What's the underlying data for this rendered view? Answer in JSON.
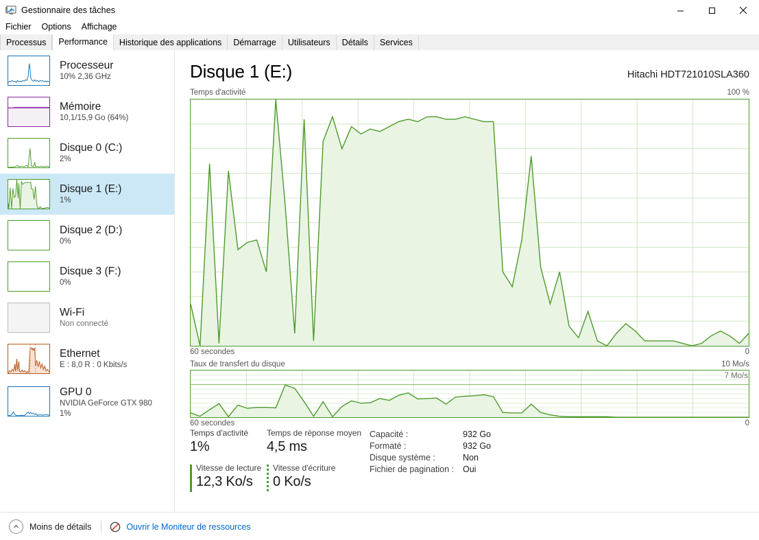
{
  "window": {
    "title": "Gestionnaire des tâches",
    "icon": "task-manager-icon",
    "minimize_glyph": "—",
    "maximize_glyph": "☐",
    "close_glyph": "✕"
  },
  "menu": {
    "items": [
      {
        "label": "Fichier"
      },
      {
        "label": "Options"
      },
      {
        "label": "Affichage"
      }
    ]
  },
  "tabs": {
    "active": "Performance",
    "items": [
      {
        "label": "Processus"
      },
      {
        "label": "Performance"
      },
      {
        "label": "Historique des applications"
      },
      {
        "label": "Démarrage"
      },
      {
        "label": "Utilisateurs"
      },
      {
        "label": "Détails"
      },
      {
        "label": "Services"
      }
    ]
  },
  "sidebar": {
    "items": [
      {
        "name": "cpu",
        "title": "Processeur",
        "sub": "10% 2,36 GHz",
        "color": "#1473b5",
        "selected": false,
        "muted": false
      },
      {
        "name": "memory",
        "title": "Mémoire",
        "sub": "10,1/15,9 Go (64%)",
        "color": "#8b24a8",
        "selected": false,
        "muted": false
      },
      {
        "name": "disk-0-c",
        "title": "Disque 0 (C:)",
        "sub": "2%",
        "color": "#4c9a2a",
        "selected": false,
        "muted": false
      },
      {
        "name": "disk-1-e",
        "title": "Disque 1 (E:)",
        "sub": "1%",
        "color": "#4c9a2a",
        "selected": true,
        "muted": false
      },
      {
        "name": "disk-2-d",
        "title": "Disque 2 (D:)",
        "sub": "0%",
        "color": "#4c9a2a",
        "selected": false,
        "muted": false
      },
      {
        "name": "disk-3-f",
        "title": "Disque 3 (F:)",
        "sub": "0%",
        "color": "#4c9a2a",
        "selected": false,
        "muted": false
      },
      {
        "name": "wifi",
        "title": "Wi-Fi",
        "sub": "Non connecté",
        "color": "#a8a8a8",
        "selected": false,
        "muted": true
      },
      {
        "name": "ethernet",
        "title": "Ethernet",
        "sub": "E : 8,0 R : 0 Kbits/s",
        "color": "#b5551d",
        "selected": false,
        "muted": false
      },
      {
        "name": "gpu-0",
        "title": "GPU 0",
        "sub": "NVIDIA GeForce GTX 980",
        "sub2": "1%",
        "color": "#1473b5",
        "selected": false,
        "muted": false
      }
    ]
  },
  "panel": {
    "title": "Disque 1 (E:)",
    "device": "Hitachi HDT721010SLA360",
    "activity_graph": {
      "label": "Temps d'activité",
      "max_label": "100 %",
      "x_label": "60 secondes",
      "min_label": "0"
    },
    "transfer_graph": {
      "label": "Taux de transfert du disque",
      "max_label": "10 Mo/s",
      "scale_label": "7 Mo/s",
      "x_label": "60 secondes",
      "min_label": "0"
    },
    "stats": {
      "active_time_label": "Temps d'activité",
      "active_time_value": "1%",
      "avg_response_label": "Temps de réponse moyen",
      "avg_response_value": "4,5 ms",
      "read_speed_label": "Vitesse de lecture",
      "read_speed_value": "12,3 Ko/s",
      "write_speed_label": "Vitesse d'écriture",
      "write_speed_value": "0 Ko/s"
    },
    "info": [
      {
        "key": "Capacité :",
        "value": "932 Go"
      },
      {
        "key": "Formaté :",
        "value": "932 Go"
      },
      {
        "key": "Disque système :",
        "value": "Non"
      },
      {
        "key": "Fichier de pagination :",
        "value": "Oui"
      }
    ]
  },
  "footer": {
    "collapse_label": "Moins de détails",
    "resource_monitor_label": "Ouvrir le Moniteur de ressources"
  },
  "colors": {
    "disk_line": "#4c9a2a",
    "disk_fill": "#e9f4e3",
    "cpu": "#1473b5",
    "memory": "#8b24a8",
    "ethernet": "#b5551d",
    "selection": "#cce8f7",
    "link": "#0066cc"
  },
  "chart_data": [
    {
      "type": "area",
      "name": "activity",
      "title": "Temps d'activité",
      "xlabel": "60 secondes",
      "ylabel": "%",
      "ylim": [
        0,
        100
      ],
      "xlim": [
        0,
        60
      ],
      "grid": true,
      "grid_rows": 10,
      "grid_cols": 10,
      "values": [
        17,
        0,
        74,
        1,
        71,
        39,
        41,
        43,
        30,
        100,
        57,
        5,
        92,
        2,
        83,
        93,
        80,
        89,
        86,
        88,
        87,
        90,
        92,
        92,
        91,
        93,
        93,
        92,
        92,
        93,
        92,
        91,
        91,
        30,
        24,
        43,
        77,
        34,
        17,
        30,
        8,
        3,
        14,
        2,
        0,
        5,
        9,
        6,
        2,
        2,
        2,
        2,
        1,
        0,
        1,
        4,
        6,
        4,
        2,
        5
      ]
    },
    {
      "type": "area",
      "name": "disk_transfer",
      "title": "Taux de transfert du disque",
      "xlabel": "60 secondes",
      "ylabel": "Mo/s",
      "ylim": [
        0,
        10
      ],
      "xlim": [
        0,
        60
      ],
      "grid": true,
      "grid_rows": 10,
      "grid_cols": 10,
      "scale_line": 7,
      "values": [
        0.9,
        0.2,
        1.6,
        2.9,
        0.1,
        2.6,
        1.9,
        2.1,
        2.1,
        2.0,
        6.9,
        6.2,
        3.3,
        0.2,
        3.3,
        0.1,
        2.3,
        3.5,
        3.0,
        3.1,
        4.0,
        3.6,
        4.7,
        5.2,
        3.9,
        4.0,
        4.1,
        2.8,
        4.3,
        4.5,
        4.6,
        4.8,
        4.4,
        1.0,
        0.9,
        0.9,
        2.8,
        1.0,
        0.5,
        0.2,
        0.1,
        0.1,
        0.1,
        0.1,
        0.1,
        0.1,
        0.1,
        0.0,
        0.0,
        0.0,
        0.0,
        0.0,
        0.0,
        0.0,
        0.0,
        0.0,
        0.0,
        0.0,
        0.0,
        0.0
      ]
    }
  ]
}
